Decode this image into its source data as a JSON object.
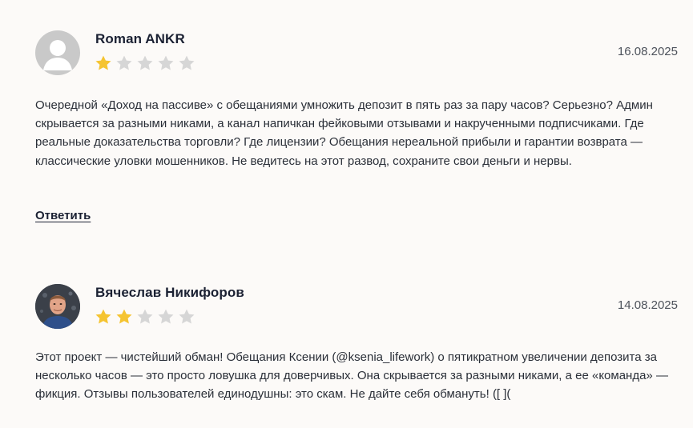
{
  "reviews": [
    {
      "author": "Roman ANKR",
      "date": "16.08.2025",
      "rating": 1,
      "max_rating": 5,
      "avatar": "user-placeholder-icon",
      "text": "Очередной «Доход на пассиве» с обещаниями умножить депозит в пять раз за пару часов? Серьезно? Админ скрывается за разными никами, а канал напичкан фейковыми отзывами и накрученными подписчиками. Где реальные доказательства торговли? Где лицензии? Обещания нереальной прибыли и гарантии возврата — классические уловки мошенников. Не ведитесь на этот развод, сохраните свои деньги и нервы.",
      "reply_label": "Ответить"
    },
    {
      "author": "Вячеслав Никифоров",
      "date": "14.08.2025",
      "rating": 2,
      "max_rating": 5,
      "avatar": "user-photo",
      "text": "Этот проект — чистейший обман! Обещания Ксении (@ksenia_lifework) о пятикратном увеличении депозита за несколько часов — это просто ловушка для доверчивых. Она скрывается за разными никами, а ее «команда» — фикция. Отзывы пользователей единодушны: это скам. Не дайте себя обмануть! ([ ]("
    }
  ],
  "colors": {
    "star_filled": "#f5c431",
    "star_empty": "#d6d6d6",
    "background": "#fcfaf8"
  }
}
